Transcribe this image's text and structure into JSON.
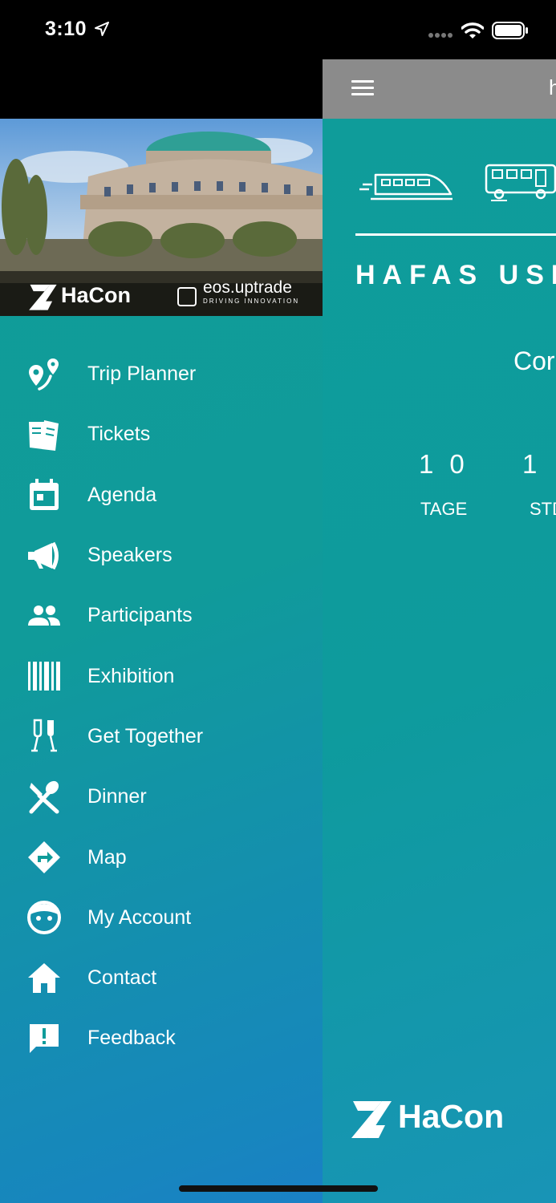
{
  "status_bar": {
    "time": "3:10"
  },
  "main": {
    "topbar_text": "h",
    "hero_title": "HAFAS USE",
    "subtitle": "Cor",
    "countdown": [
      {
        "value": "10",
        "label": "TAGE"
      },
      {
        "value": "1",
        "label": "STD"
      }
    ],
    "logo_text": "HaCon"
  },
  "drawer": {
    "header": {
      "hacon_logo_text": "HaCon",
      "eos_name": "eos.uptrade",
      "eos_tagline": "DRIVING INNOVATION"
    },
    "items": [
      {
        "label": "Trip Planner",
        "icon": "route-pin-icon"
      },
      {
        "label": "Tickets",
        "icon": "ticket-icon"
      },
      {
        "label": "Agenda",
        "icon": "calendar-icon"
      },
      {
        "label": "Speakers",
        "icon": "megaphone-icon"
      },
      {
        "label": "Participants",
        "icon": "people-icon"
      },
      {
        "label": "Exhibition",
        "icon": "barcode-icon"
      },
      {
        "label": "Get Together",
        "icon": "champagne-icon"
      },
      {
        "label": "Dinner",
        "icon": "fork-spoon-icon"
      },
      {
        "label": "Map",
        "icon": "directions-icon"
      },
      {
        "label": "My Account",
        "icon": "face-icon"
      },
      {
        "label": "Contact",
        "icon": "home-icon"
      },
      {
        "label": "Feedback",
        "icon": "feedback-icon"
      }
    ]
  },
  "colors": {
    "teal": "#0f9c9a",
    "blue": "#1a80c6",
    "topbar_gray": "#8b8b8b"
  }
}
